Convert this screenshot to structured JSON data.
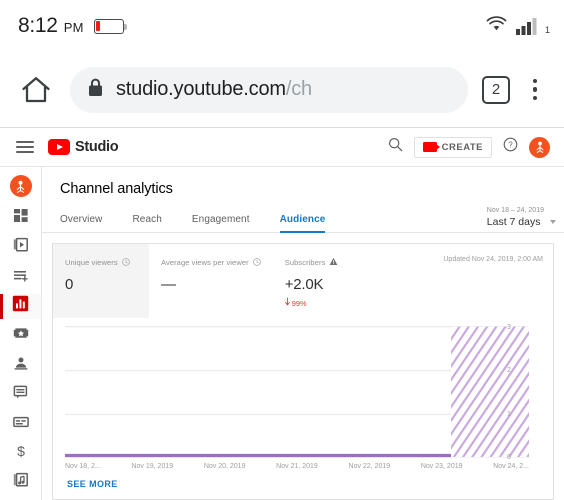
{
  "status_bar": {
    "time": "8:12",
    "ampm": "PM",
    "battery_icon": "battery-low-icon",
    "wifi_icon": "wifi-icon",
    "signal_icon": "signal-bars-icon",
    "signal_sub": "1"
  },
  "browser": {
    "home_icon": "home-icon",
    "lock_icon": "lock-icon",
    "url_visible": "studio.youtube.com",
    "url_dim": "/ch",
    "tab_count": "2",
    "menu_icon": "kebab-menu-icon"
  },
  "yt_header": {
    "menu_icon": "hamburger-menu-icon",
    "logo_text": "Studio",
    "search_icon": "search-icon",
    "create_label": "CREATE",
    "create_icon": "video-camera-icon",
    "help_icon": "help-circle-icon",
    "avatar_icon": "account-avatar"
  },
  "sidebar": {
    "items": [
      {
        "name": "channel-avatar",
        "icon": "account-avatar"
      },
      {
        "name": "dashboard",
        "icon": "dashboard-grid-icon"
      },
      {
        "name": "videos",
        "icon": "video-library-icon"
      },
      {
        "name": "playlists",
        "icon": "playlist-add-icon"
      },
      {
        "name": "analytics",
        "icon": "bar-chart-icon",
        "active": true
      },
      {
        "name": "editor",
        "icon": "film-star-icon"
      },
      {
        "name": "audience",
        "icon": "person-icon"
      },
      {
        "name": "comments",
        "icon": "comment-bubble-icon"
      },
      {
        "name": "subtitles",
        "icon": "subtitles-cc-icon"
      },
      {
        "name": "monetization",
        "icon": "dollar-sign-icon"
      },
      {
        "name": "audio-library",
        "icon": "music-note-icon"
      }
    ]
  },
  "page": {
    "title": "Channel analytics",
    "tabs": [
      {
        "label": "Overview",
        "active": false
      },
      {
        "label": "Reach",
        "active": false
      },
      {
        "label": "Engagement",
        "active": false
      },
      {
        "label": "Audience",
        "active": true
      }
    ],
    "date_range": {
      "range": "Nov 18 – 24, 2019",
      "preset": "Last 7 days"
    },
    "updated": "Updated Nov 24, 2019, 2:00 AM",
    "see_more": "SEE MORE"
  },
  "metrics": [
    {
      "label": "Unique viewers",
      "value": "0",
      "info_icon": "clock-info-icon",
      "selected": true,
      "delta": null
    },
    {
      "label": "Average views per viewer",
      "value": "—",
      "info_icon": "clock-info-icon",
      "selected": false,
      "delta": null
    },
    {
      "label": "Subscribers",
      "value": "+2.0K",
      "info_icon": "warning-triangle-icon",
      "selected": false,
      "delta": "99%",
      "delta_dir": "down",
      "delta_color": "#e53935"
    }
  ],
  "chart_data": {
    "type": "line",
    "title": "",
    "xlabel": "",
    "ylabel": "",
    "x": [
      "Nov 18, 2...",
      "Nov 19, 2019",
      "Nov 20, 2019",
      "Nov 21, 2019",
      "Nov 22, 2019",
      "Nov 23, 2019",
      "Nov 24, 2..."
    ],
    "series": [
      {
        "name": "Unique viewers",
        "values": [
          0,
          0,
          0,
          0,
          0,
          0,
          0
        ],
        "color": "#9c6fc4"
      }
    ],
    "yticks": [
      "3",
      "2",
      "1",
      "0"
    ],
    "ylim": [
      0,
      3
    ],
    "grid": true,
    "shaded_region": {
      "label": "incomplete-data",
      "from_index": 5,
      "to_index": 6,
      "pattern": "diagonal-hatch",
      "color": "#c9a9e0"
    }
  }
}
